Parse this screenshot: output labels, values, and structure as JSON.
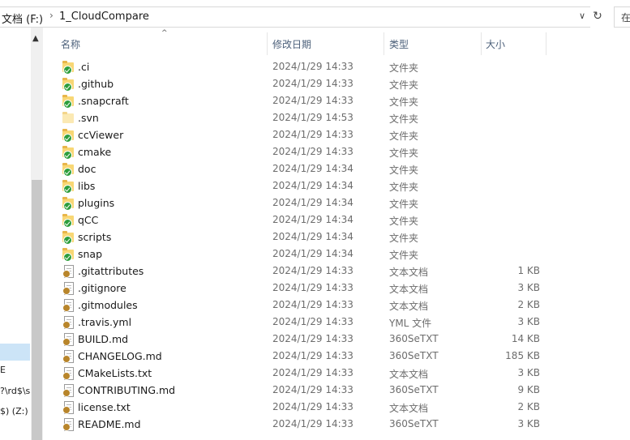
{
  "address": {
    "drive": "文档 (F:)",
    "folder": "1_CloudCompare",
    "search_placeholder": "在"
  },
  "nav": {
    "items": [
      {
        "label": ""
      },
      {
        "label": "E"
      },
      {
        "label": "?\\rd$\\s"
      },
      {
        "label": "$) (Z:)"
      }
    ]
  },
  "columns": {
    "name": "名称",
    "date": "修改日期",
    "type": "类型",
    "size": "大小"
  },
  "files": [
    {
      "name": ".ci",
      "date": "2024/1/29 14:33",
      "type": "文件夹",
      "size": "",
      "icon": "folder-synced-icon"
    },
    {
      "name": ".github",
      "date": "2024/1/29 14:33",
      "type": "文件夹",
      "size": "",
      "icon": "folder-synced-icon"
    },
    {
      "name": ".snapcraft",
      "date": "2024/1/29 14:33",
      "type": "文件夹",
      "size": "",
      "icon": "folder-synced-icon"
    },
    {
      "name": ".svn",
      "date": "2024/1/29 14:53",
      "type": "文件夹",
      "size": "",
      "icon": "folder-icon"
    },
    {
      "name": "ccViewer",
      "date": "2024/1/29 14:33",
      "type": "文件夹",
      "size": "",
      "icon": "folder-synced-icon"
    },
    {
      "name": "cmake",
      "date": "2024/1/29 14:33",
      "type": "文件夹",
      "size": "",
      "icon": "folder-synced-icon"
    },
    {
      "name": "doc",
      "date": "2024/1/29 14:34",
      "type": "文件夹",
      "size": "",
      "icon": "folder-synced-icon"
    },
    {
      "name": "libs",
      "date": "2024/1/29 14:34",
      "type": "文件夹",
      "size": "",
      "icon": "folder-synced-icon"
    },
    {
      "name": "plugins",
      "date": "2024/1/29 14:34",
      "type": "文件夹",
      "size": "",
      "icon": "folder-synced-icon"
    },
    {
      "name": "qCC",
      "date": "2024/1/29 14:34",
      "type": "文件夹",
      "size": "",
      "icon": "folder-synced-icon"
    },
    {
      "name": "scripts",
      "date": "2024/1/29 14:34",
      "type": "文件夹",
      "size": "",
      "icon": "folder-synced-icon"
    },
    {
      "name": "snap",
      "date": "2024/1/29 14:34",
      "type": "文件夹",
      "size": "",
      "icon": "folder-synced-icon"
    },
    {
      "name": ".gitattributes",
      "date": "2024/1/29 14:33",
      "type": "文本文档",
      "size": "1 KB",
      "icon": "text-file-icon"
    },
    {
      "name": ".gitignore",
      "date": "2024/1/29 14:33",
      "type": "文本文档",
      "size": "3 KB",
      "icon": "text-file-icon"
    },
    {
      "name": ".gitmodules",
      "date": "2024/1/29 14:33",
      "type": "文本文档",
      "size": "2 KB",
      "icon": "text-file-icon"
    },
    {
      "name": ".travis.yml",
      "date": "2024/1/29 14:33",
      "type": "YML 文件",
      "size": "3 KB",
      "icon": "text-file-icon"
    },
    {
      "name": "BUILD.md",
      "date": "2024/1/29 14:33",
      "type": "360SeTXT",
      "size": "14 KB",
      "icon": "text-file-icon"
    },
    {
      "name": "CHANGELOG.md",
      "date": "2024/1/29 14:33",
      "type": "360SeTXT",
      "size": "185 KB",
      "icon": "text-file-icon"
    },
    {
      "name": "CMakeLists.txt",
      "date": "2024/1/29 14:33",
      "type": "文本文档",
      "size": "3 KB",
      "icon": "text-file-icon"
    },
    {
      "name": "CONTRIBUTING.md",
      "date": "2024/1/29 14:33",
      "type": "360SeTXT",
      "size": "9 KB",
      "icon": "text-file-icon"
    },
    {
      "name": "license.txt",
      "date": "2024/1/29 14:33",
      "type": "文本文档",
      "size": "2 KB",
      "icon": "text-file-icon"
    },
    {
      "name": "README.md",
      "date": "2024/1/29 14:33",
      "type": "360SeTXT",
      "size": "3 KB",
      "icon": "text-file-icon"
    }
  ]
}
